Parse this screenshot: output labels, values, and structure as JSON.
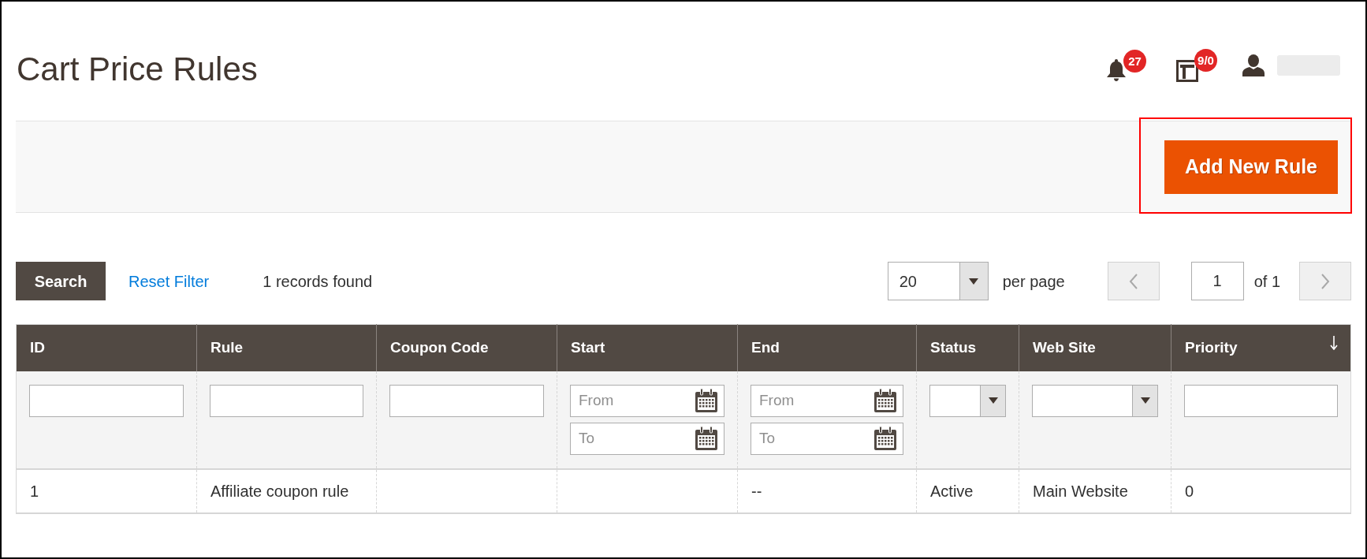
{
  "page": {
    "title": "Cart Price Rules"
  },
  "header_actions": {
    "notifications": {
      "count": "27"
    },
    "system_messages": {
      "count": "9/0"
    }
  },
  "page_actions": {
    "add_button": {
      "label": "Add New Rule",
      "highlighted": true
    }
  },
  "toolbar": {
    "search_button": "Search",
    "reset_link": "Reset Filter",
    "records_found": "1 records found",
    "per_page": {
      "value": "20",
      "label": "per page"
    },
    "pagination": {
      "previous": {
        "disabled": true
      },
      "page": "1",
      "of_pages": "of 1",
      "next": {
        "disabled": true
      }
    }
  },
  "table": {
    "columns": [
      {
        "label": "ID",
        "sorted": false,
        "filter": {
          "kind": "text"
        }
      },
      {
        "label": "Rule",
        "sorted": false,
        "filter": {
          "kind": "text"
        }
      },
      {
        "label": "Coupon Code",
        "sorted": false,
        "filter": {
          "kind": "text"
        }
      },
      {
        "label": "Start",
        "sorted": false,
        "filter": {
          "kind": "date_range",
          "from_placeholder": "From",
          "to_placeholder": "To"
        }
      },
      {
        "label": "End",
        "sorted": false,
        "filter": {
          "kind": "date_range",
          "from_placeholder": "From",
          "to_placeholder": "To"
        }
      },
      {
        "label": "Status",
        "sorted": false,
        "filter": {
          "kind": "select"
        }
      },
      {
        "label": "Web Site",
        "sorted": false,
        "filter": {
          "kind": "select"
        }
      },
      {
        "label": "Priority",
        "sorted": true,
        "filter": {
          "kind": "text"
        }
      }
    ],
    "rows": [
      {
        "cells": [
          "1",
          "Affiliate coupon rule",
          null,
          null,
          "--",
          "Active",
          "Main Website",
          "0"
        ]
      }
    ]
  }
}
